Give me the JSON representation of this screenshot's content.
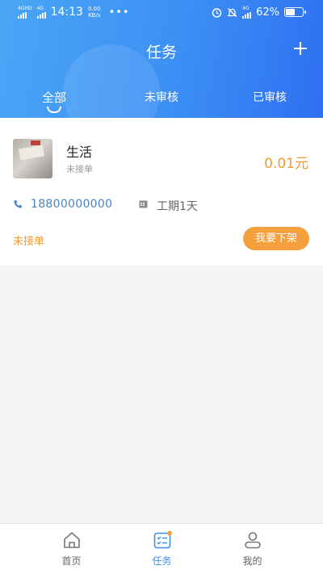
{
  "status_bar": {
    "network_1": "4GHD",
    "network_2": "4G",
    "time": "14:13",
    "speed_value": "0.00",
    "speed_unit": "KB/s",
    "network_3": "4G",
    "battery": "62%",
    "battery_level": 0.62
  },
  "header": {
    "title": "任务"
  },
  "tabs": [
    {
      "label": "全部",
      "active": true
    },
    {
      "label": "未审核"
    },
    {
      "label": "已审核"
    }
  ],
  "task": {
    "name": "生活",
    "status": "未接单",
    "price": "0.01元",
    "phone": "18800000000",
    "period": "工期1天",
    "footer_status": "未接单",
    "action_label": "我要下架"
  },
  "bottom_nav": [
    {
      "label": "首页",
      "icon": "home-icon"
    },
    {
      "label": "任务",
      "icon": "task-list-icon",
      "active": true
    },
    {
      "label": "我的",
      "icon": "user-icon"
    }
  ],
  "colors": {
    "accent": "#3b8ef0",
    "price": "#f29a2e",
    "button": "#f5a03c",
    "phone": "#4a82c4"
  }
}
